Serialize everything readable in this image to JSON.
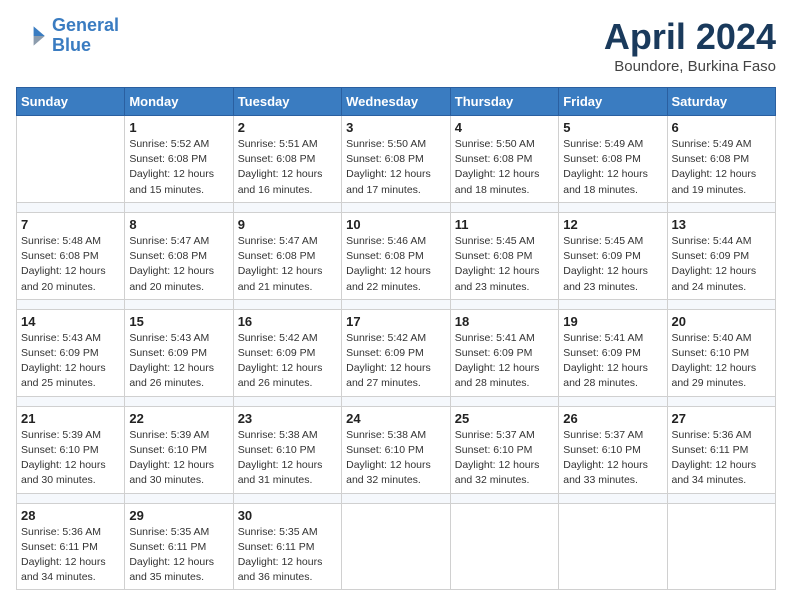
{
  "header": {
    "logo_line1": "General",
    "logo_line2": "Blue",
    "month": "April 2024",
    "location": "Boundore, Burkina Faso"
  },
  "weekdays": [
    "Sunday",
    "Monday",
    "Tuesday",
    "Wednesday",
    "Thursday",
    "Friday",
    "Saturday"
  ],
  "weeks": [
    [
      {
        "day": "",
        "info": ""
      },
      {
        "day": "1",
        "info": "Sunrise: 5:52 AM\nSunset: 6:08 PM\nDaylight: 12 hours\nand 15 minutes."
      },
      {
        "day": "2",
        "info": "Sunrise: 5:51 AM\nSunset: 6:08 PM\nDaylight: 12 hours\nand 16 minutes."
      },
      {
        "day": "3",
        "info": "Sunrise: 5:50 AM\nSunset: 6:08 PM\nDaylight: 12 hours\nand 17 minutes."
      },
      {
        "day": "4",
        "info": "Sunrise: 5:50 AM\nSunset: 6:08 PM\nDaylight: 12 hours\nand 18 minutes."
      },
      {
        "day": "5",
        "info": "Sunrise: 5:49 AM\nSunset: 6:08 PM\nDaylight: 12 hours\nand 18 minutes."
      },
      {
        "day": "6",
        "info": "Sunrise: 5:49 AM\nSunset: 6:08 PM\nDaylight: 12 hours\nand 19 minutes."
      }
    ],
    [
      {
        "day": "7",
        "info": "Sunrise: 5:48 AM\nSunset: 6:08 PM\nDaylight: 12 hours\nand 20 minutes."
      },
      {
        "day": "8",
        "info": "Sunrise: 5:47 AM\nSunset: 6:08 PM\nDaylight: 12 hours\nand 20 minutes."
      },
      {
        "day": "9",
        "info": "Sunrise: 5:47 AM\nSunset: 6:08 PM\nDaylight: 12 hours\nand 21 minutes."
      },
      {
        "day": "10",
        "info": "Sunrise: 5:46 AM\nSunset: 6:08 PM\nDaylight: 12 hours\nand 22 minutes."
      },
      {
        "day": "11",
        "info": "Sunrise: 5:45 AM\nSunset: 6:08 PM\nDaylight: 12 hours\nand 23 minutes."
      },
      {
        "day": "12",
        "info": "Sunrise: 5:45 AM\nSunset: 6:09 PM\nDaylight: 12 hours\nand 23 minutes."
      },
      {
        "day": "13",
        "info": "Sunrise: 5:44 AM\nSunset: 6:09 PM\nDaylight: 12 hours\nand 24 minutes."
      }
    ],
    [
      {
        "day": "14",
        "info": "Sunrise: 5:43 AM\nSunset: 6:09 PM\nDaylight: 12 hours\nand 25 minutes."
      },
      {
        "day": "15",
        "info": "Sunrise: 5:43 AM\nSunset: 6:09 PM\nDaylight: 12 hours\nand 26 minutes."
      },
      {
        "day": "16",
        "info": "Sunrise: 5:42 AM\nSunset: 6:09 PM\nDaylight: 12 hours\nand 26 minutes."
      },
      {
        "day": "17",
        "info": "Sunrise: 5:42 AM\nSunset: 6:09 PM\nDaylight: 12 hours\nand 27 minutes."
      },
      {
        "day": "18",
        "info": "Sunrise: 5:41 AM\nSunset: 6:09 PM\nDaylight: 12 hours\nand 28 minutes."
      },
      {
        "day": "19",
        "info": "Sunrise: 5:41 AM\nSunset: 6:09 PM\nDaylight: 12 hours\nand 28 minutes."
      },
      {
        "day": "20",
        "info": "Sunrise: 5:40 AM\nSunset: 6:10 PM\nDaylight: 12 hours\nand 29 minutes."
      }
    ],
    [
      {
        "day": "21",
        "info": "Sunrise: 5:39 AM\nSunset: 6:10 PM\nDaylight: 12 hours\nand 30 minutes."
      },
      {
        "day": "22",
        "info": "Sunrise: 5:39 AM\nSunset: 6:10 PM\nDaylight: 12 hours\nand 30 minutes."
      },
      {
        "day": "23",
        "info": "Sunrise: 5:38 AM\nSunset: 6:10 PM\nDaylight: 12 hours\nand 31 minutes."
      },
      {
        "day": "24",
        "info": "Sunrise: 5:38 AM\nSunset: 6:10 PM\nDaylight: 12 hours\nand 32 minutes."
      },
      {
        "day": "25",
        "info": "Sunrise: 5:37 AM\nSunset: 6:10 PM\nDaylight: 12 hours\nand 32 minutes."
      },
      {
        "day": "26",
        "info": "Sunrise: 5:37 AM\nSunset: 6:10 PM\nDaylight: 12 hours\nand 33 minutes."
      },
      {
        "day": "27",
        "info": "Sunrise: 5:36 AM\nSunset: 6:11 PM\nDaylight: 12 hours\nand 34 minutes."
      }
    ],
    [
      {
        "day": "28",
        "info": "Sunrise: 5:36 AM\nSunset: 6:11 PM\nDaylight: 12 hours\nand 34 minutes."
      },
      {
        "day": "29",
        "info": "Sunrise: 5:35 AM\nSunset: 6:11 PM\nDaylight: 12 hours\nand 35 minutes."
      },
      {
        "day": "30",
        "info": "Sunrise: 5:35 AM\nSunset: 6:11 PM\nDaylight: 12 hours\nand 36 minutes."
      },
      {
        "day": "",
        "info": ""
      },
      {
        "day": "",
        "info": ""
      },
      {
        "day": "",
        "info": ""
      },
      {
        "day": "",
        "info": ""
      }
    ]
  ]
}
